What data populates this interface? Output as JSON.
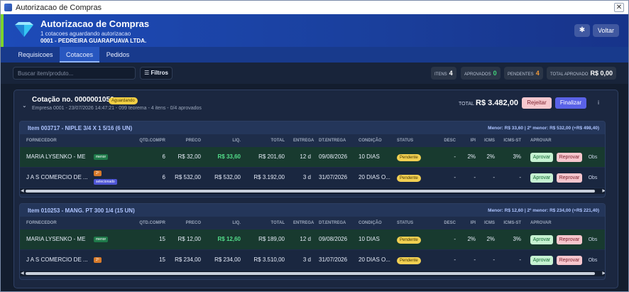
{
  "window": {
    "title": "Autorizacao de Compras",
    "close": "✕"
  },
  "header": {
    "title": "Autorizacao de Compras",
    "subtitle": "1 cotacoes aguardando autorizacao",
    "company": "0001 - PEDREIRA GUARAPUAVA LTDA.",
    "theme_icon": "✱",
    "voltar": "Voltar"
  },
  "tabs": [
    {
      "label": "Requisicoes"
    },
    {
      "label": "Cotacoes"
    },
    {
      "label": "Pedidos"
    }
  ],
  "toolbar": {
    "search_placeholder": "Buscar item/produto...",
    "filter_label": "☰ Filtros",
    "stats": [
      {
        "label": "ITENS",
        "value": "4",
        "color": "#ffffff"
      },
      {
        "label": "APROVADOS",
        "value": "0",
        "color": "#3fd47a"
      },
      {
        "label": "PENDENTES",
        "value": "4",
        "color": "#f29a3a"
      },
      {
        "label": "TOTAL APROVADO",
        "value": "R$ 0,00",
        "color": "#ffffff"
      }
    ]
  },
  "cotacao": {
    "chevron": "⌄",
    "title": "Cotação no. 0000001056",
    "status": "Aguardando",
    "meta": "Empresa 0001 - 23/07/2026 14:47:21 - 099 teorema - 4 itens - 0/4 aprovados",
    "total_label": "TOTAL",
    "total_value": "R$ 3.482,00",
    "reject": "Rejeitar",
    "finalize": "Finalizar",
    "info_icon": "i"
  },
  "columns": [
    "FORNECEDOR",
    "QTD.COMPR",
    "PRECO",
    "LIQ.",
    "TOTAL",
    "ENTREGA",
    "DT.ENTREGA",
    "CONDIÇÃO",
    "STATUS",
    "DESC",
    "IPI",
    "ICMS",
    "ICMS-ST",
    "APROVAR"
  ],
  "items": [
    {
      "title": "Item 003717 - NIPLE 3/4 X 1 5/16 (6 UN)",
      "menor": "Menor: R$ 33,60 | 2º menor: R$ 532,00 (+R$ 498,40)",
      "rows": [
        {
          "fornecedor": "MARIA LYSENKO - ME",
          "tags": [
            "menor"
          ],
          "qtd": "6",
          "preco": "R$ 32,00",
          "liq": "R$ 33,60",
          "total": "R$ 201,60",
          "entrega": "12 d",
          "dt": "09/08/2026",
          "cond": "10 DIAS",
          "status": "Pendente",
          "desc": "-",
          "ipi": "2%",
          "icms": "2%",
          "icmsst": "3%",
          "aprovar": "Aprovar",
          "reprovar": "Reprovar",
          "obs": "Obs"
        },
        {
          "fornecedor": "J A S COMERCIO DE ...",
          "tags": [
            "2º",
            "selecionado"
          ],
          "qtd": "6",
          "preco": "R$ 532,00",
          "liq": "R$ 532,00",
          "total": "R$ 3.192,00",
          "entrega": "3 d",
          "dt": "31/07/2026",
          "cond": "20 DIAS O...",
          "status": "Pendente",
          "desc": "-",
          "ipi": "-",
          "icms": "-",
          "icmsst": "-",
          "aprovar": "Aprovar",
          "reprovar": "Reprovar",
          "obs": "Obs"
        }
      ]
    },
    {
      "title": "Item 010253 - MANG. PT 300 1/4 (15 UN)",
      "menor": "Menor: R$ 12,60 | 2º menor: R$ 234,00 (+R$ 221,40)",
      "rows": [
        {
          "fornecedor": "MARIA LYSENKO - ME",
          "tags": [
            "menor"
          ],
          "qtd": "15",
          "preco": "R$ 12,00",
          "liq": "R$ 12,60",
          "total": "R$ 189,00",
          "entrega": "12 d",
          "dt": "09/08/2026",
          "cond": "10 DIAS",
          "status": "Pendente",
          "desc": "-",
          "ipi": "2%",
          "icms": "2%",
          "icmsst": "3%",
          "aprovar": "Aprovar",
          "reprovar": "Reprovar",
          "obs": "Obs"
        },
        {
          "fornecedor": "J A S COMERCIO DE ...",
          "tags": [
            "2º"
          ],
          "qtd": "15",
          "preco": "R$ 234,00",
          "liq": "R$ 234,00",
          "total": "R$ 3.510,00",
          "entrega": "3 d",
          "dt": "31/07/2026",
          "cond": "20 DIAS O...",
          "status": "Pendente",
          "desc": "-",
          "ipi": "-",
          "icms": "-",
          "icmsst": "-",
          "aprovar": "Aprovar",
          "reprovar": "Reprovar",
          "obs": "Obs"
        }
      ]
    }
  ],
  "colors": {
    "accent_green": "#7cd42b",
    "header_blue": "#1d4bb8",
    "best_row": "#183a2f"
  }
}
